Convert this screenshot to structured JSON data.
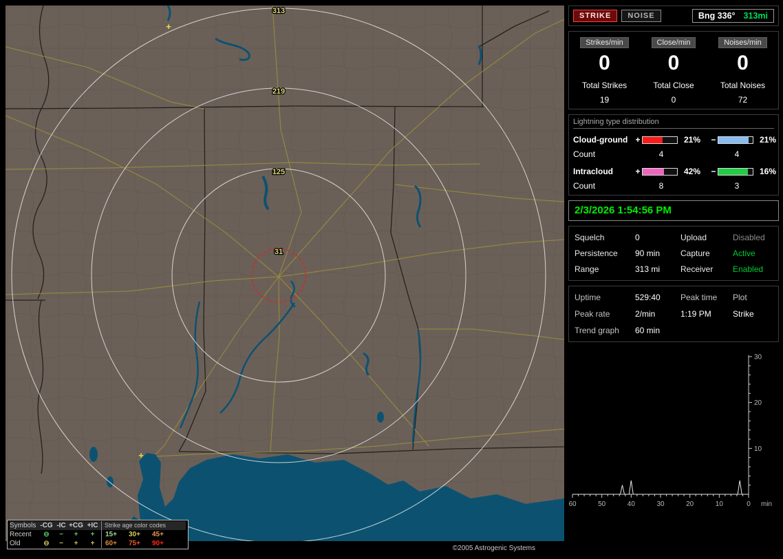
{
  "map": {
    "ring_labels": [
      "313",
      "219",
      "125",
      "31"
    ],
    "strike_glyph": "+",
    "copyright": "©2005 Astrogenic Systems",
    "legend": {
      "title_symbols": "Symbols",
      "columns": [
        "-CG",
        "-IC",
        "+CG",
        "+IC"
      ],
      "age_title": "Strike age color codes",
      "rows": [
        {
          "name": "Recent",
          "sym": [
            "⊖",
            "−",
            "+",
            "+"
          ],
          "sym_color": "#58c868",
          "ages": [
            "15+",
            "30+",
            "45+"
          ],
          "age_colors": [
            "#a8d890",
            "#d8d058",
            "#e89848"
          ]
        },
        {
          "name": "Old",
          "sym": [
            "⊖",
            "−",
            "+",
            "+"
          ],
          "sym_color": "#d0c050",
          "ages": [
            "60+",
            "75+",
            "90+"
          ],
          "age_colors": [
            "#e08838",
            "#ea5830",
            "#ff2818"
          ]
        }
      ]
    }
  },
  "panel": {
    "strike_btn": "STRIKE",
    "noise_btn": "NOISE",
    "bearing_label": "Bng 336°",
    "bearing_range": "313mi",
    "rate_columns": [
      {
        "header": "Strikes/min",
        "rate": "0",
        "total_label": "Total Strikes",
        "total": "19"
      },
      {
        "header": "Close/min",
        "rate": "0",
        "total_label": "Total Close",
        "total": "0"
      },
      {
        "header": "Noises/min",
        "rate": "0",
        "total_label": "Total Noises",
        "total": "72"
      }
    ],
    "distribution": {
      "title": "Lightning type distribution",
      "plus_sign": "+",
      "minus_sign": "−",
      "rows": [
        {
          "label": "Cloud-ground",
          "plus_pct": "21%",
          "minus_pct": "21%",
          "plus_fill": 58,
          "minus_fill": 88,
          "plus_color": "#ff1818",
          "minus_color": "#88bbee",
          "count_label": "Count",
          "plus_count": "4",
          "minus_count": "4"
        },
        {
          "label": "Intracloud",
          "plus_pct": "42%",
          "minus_pct": "16%",
          "plus_fill": 62,
          "minus_fill": 86,
          "plus_color": "#ee66bb",
          "minus_color": "#22cc44",
          "count_label": "Count",
          "plus_count": "8",
          "minus_count": "3"
        }
      ]
    },
    "clock": "2/3/2026 1:54:56 PM",
    "status": {
      "rows": [
        {
          "l1": "Squelch",
          "v1": "0",
          "l2": "Upload",
          "v2": "Disabled"
        },
        {
          "l1": "Persistence",
          "v1": "90 min",
          "l2": "Capture",
          "v2": "Active"
        },
        {
          "l1": "Range",
          "v1": "313 mi",
          "l2": "Receiver",
          "v2": "Enabled"
        }
      ]
    },
    "stats": {
      "uptime_label": "Uptime",
      "uptime": "529:40",
      "peak_time_label": "Peak time",
      "peak_time": "1:19 PM",
      "plot_label": "Plot",
      "plot": "Strike",
      "peak_rate_label": "Peak rate",
      "peak_rate": "2/min",
      "trend_label": "Trend graph",
      "trend_value": "60 min"
    }
  },
  "chart_data": {
    "type": "line",
    "title": "Strike trend graph, last 60 minutes",
    "x_unit": "min",
    "x_ticks": [
      "60",
      "50",
      "40",
      "30",
      "20",
      "10",
      "0"
    ],
    "y_ticks": [
      "10",
      "20",
      "30"
    ],
    "ylim": [
      0,
      30
    ],
    "xlim": [
      60,
      0
    ],
    "spikes": [
      {
        "min": 43,
        "value": 2
      },
      {
        "min": 40,
        "value": 3
      },
      {
        "min": 3,
        "value": 3
      }
    ]
  }
}
